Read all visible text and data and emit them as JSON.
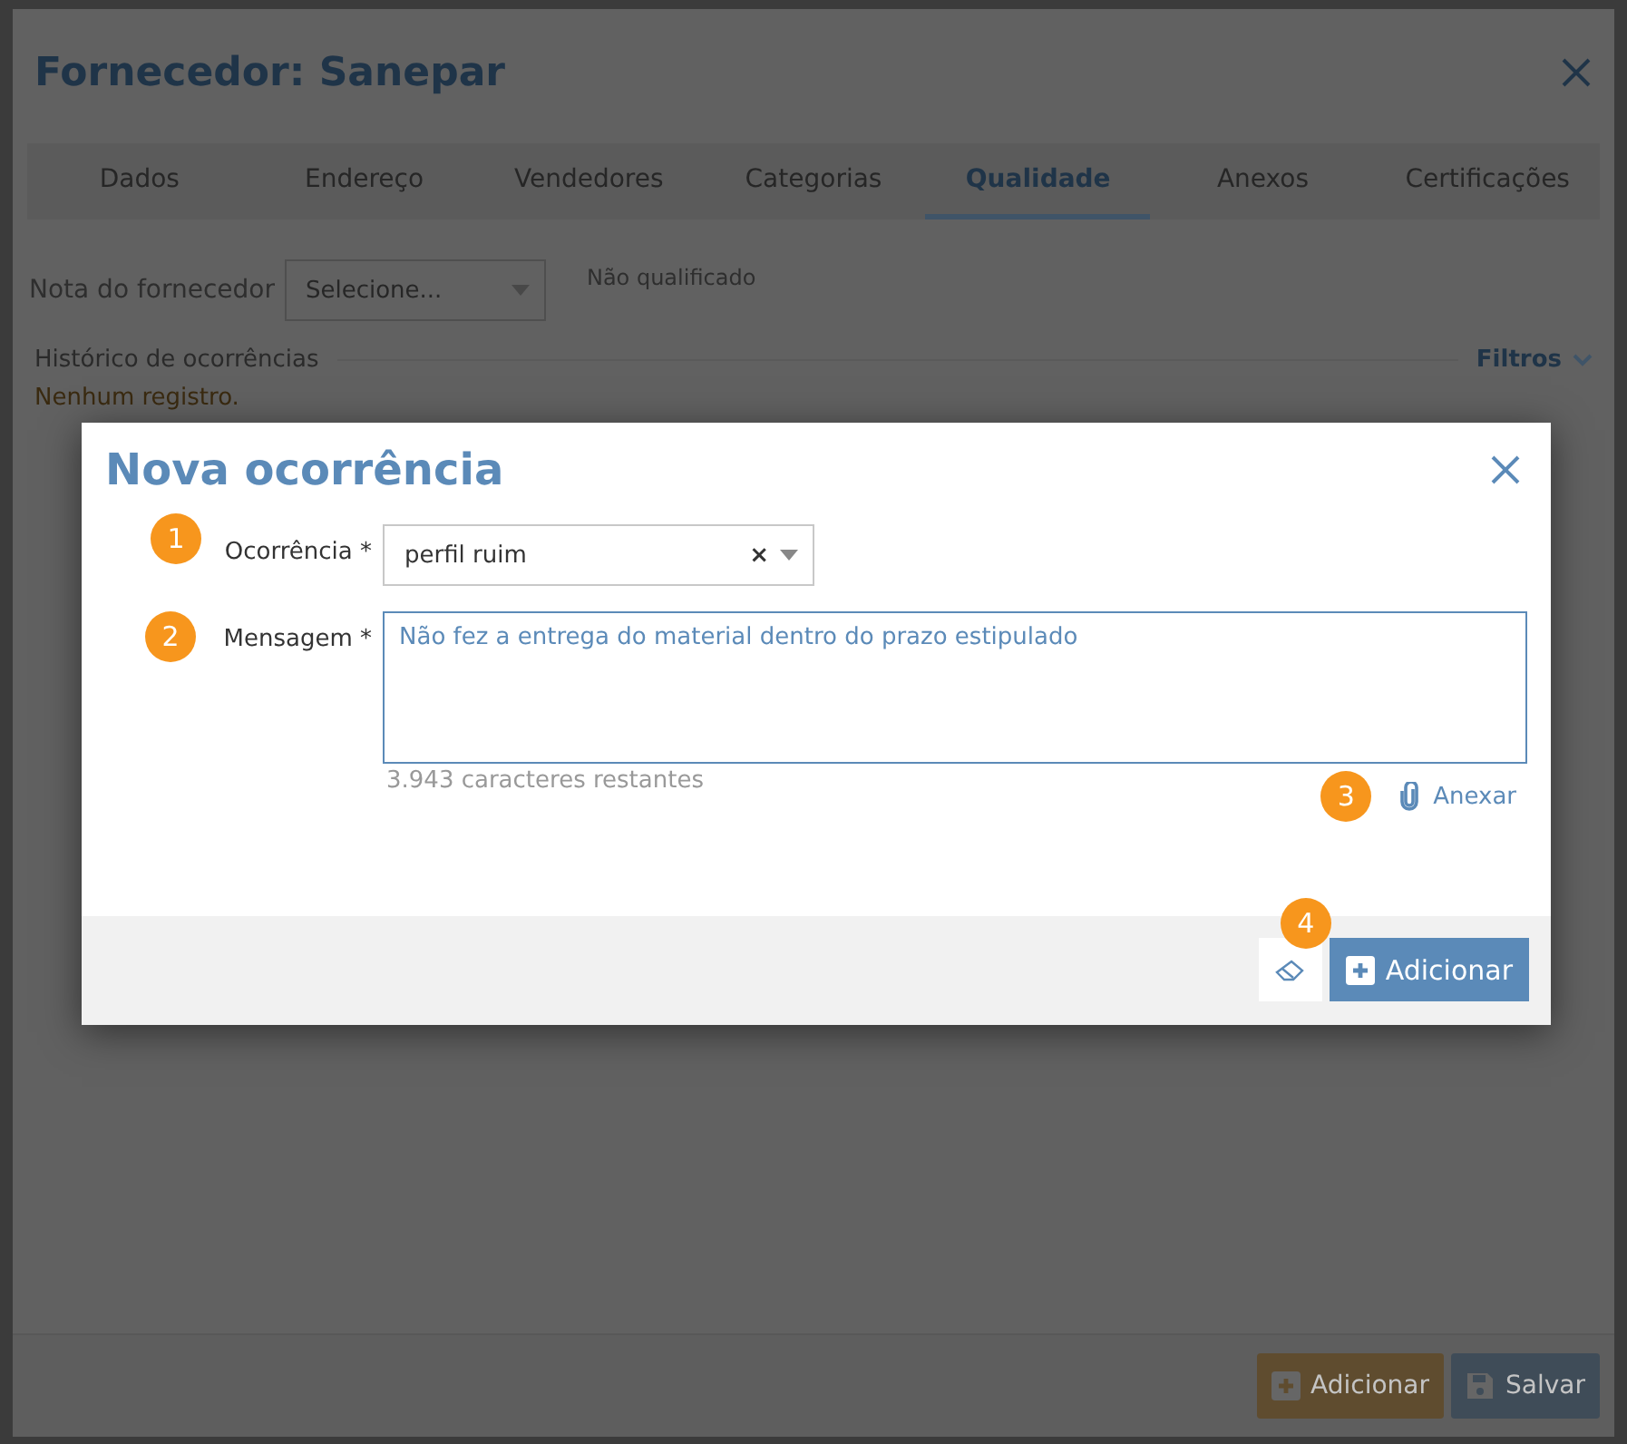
{
  "window": {
    "title": "Fornecedor: Sanepar"
  },
  "tabs": [
    {
      "label": "Dados",
      "selected": false
    },
    {
      "label": "Endereço",
      "selected": false
    },
    {
      "label": "Vendedores",
      "selected": false
    },
    {
      "label": "Categorias",
      "selected": false
    },
    {
      "label": "Qualidade",
      "selected": true
    },
    {
      "label": "Anexos",
      "selected": false
    },
    {
      "label": "Certificações",
      "selected": false
    }
  ],
  "rating": {
    "label": "Nota do fornecedor",
    "placeholder": "Selecione...",
    "status": "Não qualificado"
  },
  "history": {
    "title": "Histórico de ocorrências",
    "filters": "Filtros",
    "empty": "Nenhum registro."
  },
  "footer_buttons": [
    {
      "label": "Adicionar",
      "kind": "add"
    },
    {
      "label": "Salvar",
      "kind": "save"
    }
  ],
  "dialog": {
    "title": "Nova ocorrência",
    "occurrence": {
      "badge": "1",
      "label": "Ocorrência *",
      "value": "perfil ruim",
      "clear": "×"
    },
    "message": {
      "badge": "2",
      "label": "Mensagem *",
      "value": "Não fez a entrega do material dentro do prazo estipulado",
      "remaining": "3.943  caracteres restantes"
    },
    "attach": {
      "badge": "3",
      "label": "Anexar"
    },
    "clear_badge": "4",
    "submit": "Adicionar"
  }
}
